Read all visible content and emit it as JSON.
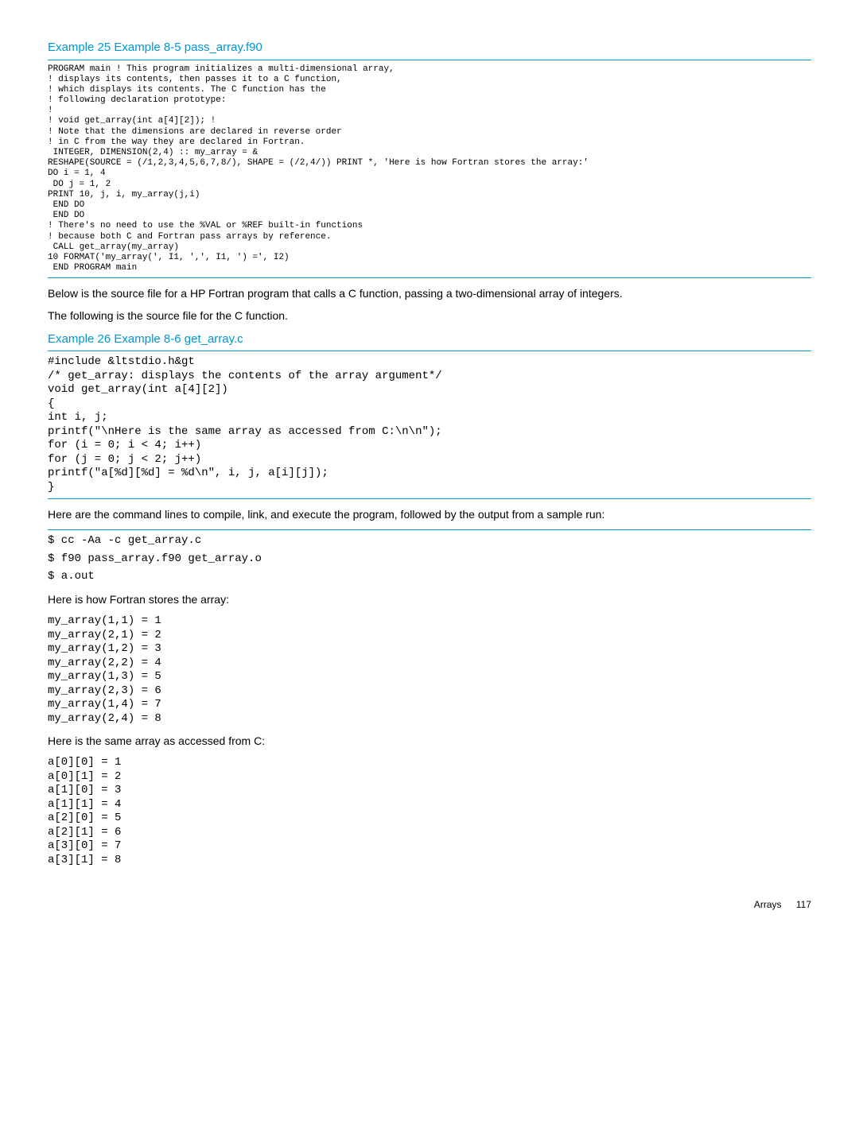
{
  "example25": {
    "title": "Example 25 Example 8-5 pass_array.f90",
    "code": "PROGRAM main ! This program initializes a multi-dimensional array,\n! displays its contents, then passes it to a C function,\n! which displays its contents. The C function has the\n! following declaration prototype:\n!\n! void get_array(int a[4][2]); !\n! Note that the dimensions are declared in reverse order\n! in C from the way they are declared in Fortran.\n INTEGER, DIMENSION(2,4) :: my_array = &\nRESHAPE(SOURCE = (/1,2,3,4,5,6,7,8/), SHAPE = (/2,4/)) PRINT *, 'Here is how Fortran stores the array:'\nDO i = 1, 4\n DO j = 1, 2\nPRINT 10, j, i, my_array(j,i)\n END DO\n END DO\n! There's no need to use the %VAL or %REF built-in functions\n! because both C and Fortran pass arrays by reference.\n CALL get_array(my_array)\n10 FORMAT('my_array(', I1, ',', I1, ') =', I2)\n END PROGRAM main"
  },
  "paragraph1": "Below is the source file for a HP Fortran program that calls a C function, passing a two-dimensional array of integers.",
  "paragraph2": "The following is the source file for the C function.",
  "example26": {
    "title": "Example 26 Example 8-6 get_array.c",
    "code": "#include &ltstdio.h&gt\n/* get_array: displays the contents of the array argument*/\nvoid get_array(int a[4][2])\n{\nint i, j;\nprintf(\"\\nHere is the same array as accessed from C:\\n\\n\");\nfor (i = 0; i < 4; i++)\nfor (j = 0; j < 2; j++)\nprintf(\"a[%d][%d] = %d\\n\", i, j, a[i][j]);\n}"
  },
  "paragraph3": "Here are the command lines to compile, link, and execute the program, followed by the output from a sample run:",
  "commands": {
    "line1": "$ cc -Aa -c get_array.c",
    "line2": "$ f90 pass_array.f90 get_array.o",
    "line3": "$ a.out"
  },
  "output_heading1": "Here is how Fortran stores the array:",
  "fortran_output": "my_array(1,1) = 1\nmy_array(2,1) = 2\nmy_array(1,2) = 3\nmy_array(2,2) = 4\nmy_array(1,3) = 5\nmy_array(2,3) = 6\nmy_array(1,4) = 7\nmy_array(2,4) = 8",
  "output_heading2": "Here is the same array as accessed from C:",
  "c_output": "a[0][0] = 1\na[0][1] = 2\na[1][0] = 3\na[1][1] = 4\na[2][0] = 5\na[2][1] = 6\na[3][0] = 7\na[3][1] = 8",
  "footer": {
    "section": "Arrays",
    "page": "117"
  }
}
